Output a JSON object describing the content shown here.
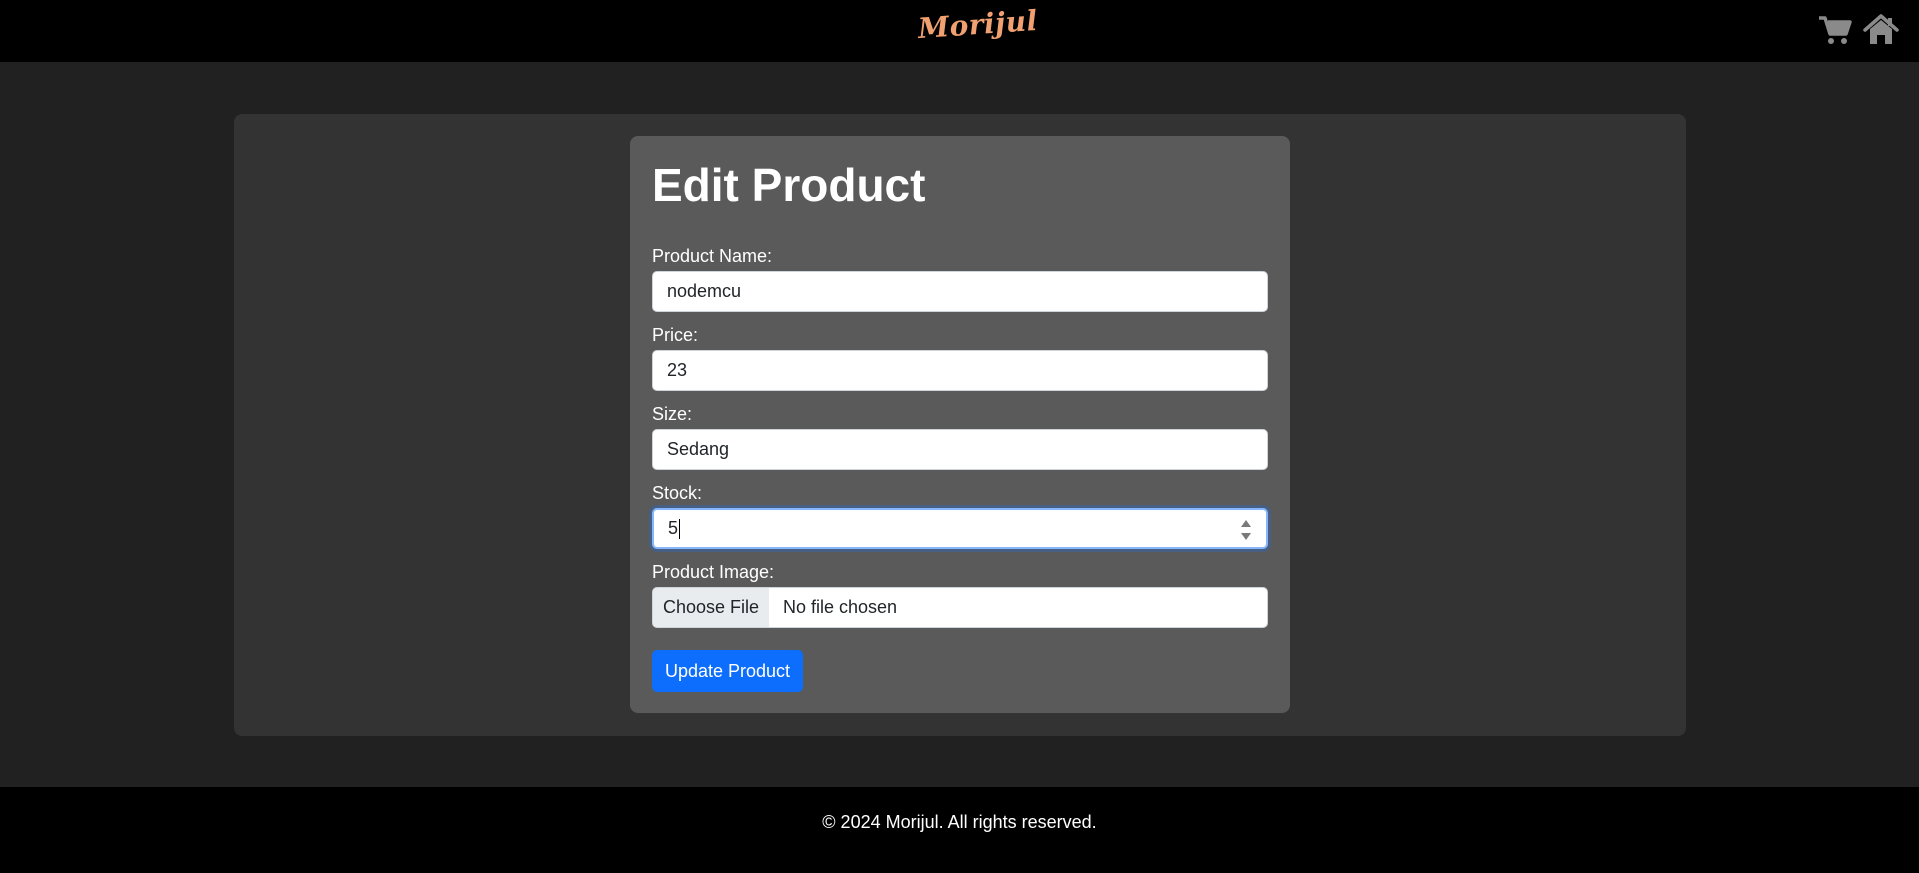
{
  "header": {
    "brand": "Morijul",
    "brand_color": "#f0a071",
    "icons": [
      "cart-icon",
      "home-icon"
    ]
  },
  "form": {
    "title": "Edit Product",
    "fields": {
      "name": {
        "label": "Product Name:",
        "value": "nodemcu"
      },
      "price": {
        "label": "Price:",
        "value": "23"
      },
      "size": {
        "label": "Size:",
        "value": "Sedang"
      },
      "stock": {
        "label": "Stock:",
        "value": "5"
      },
      "image": {
        "label": "Product Image:",
        "button_label": "Choose File",
        "status": "No file chosen"
      }
    },
    "submit_label": "Update Product"
  },
  "footer": {
    "text": "© 2024 Morijul. All rights reserved."
  },
  "colors": {
    "page_bg": "#212121",
    "bar_bg": "#000000",
    "panel_bg": "#333333",
    "card_bg": "#5a5a5a",
    "accent": "#0d6efd"
  }
}
